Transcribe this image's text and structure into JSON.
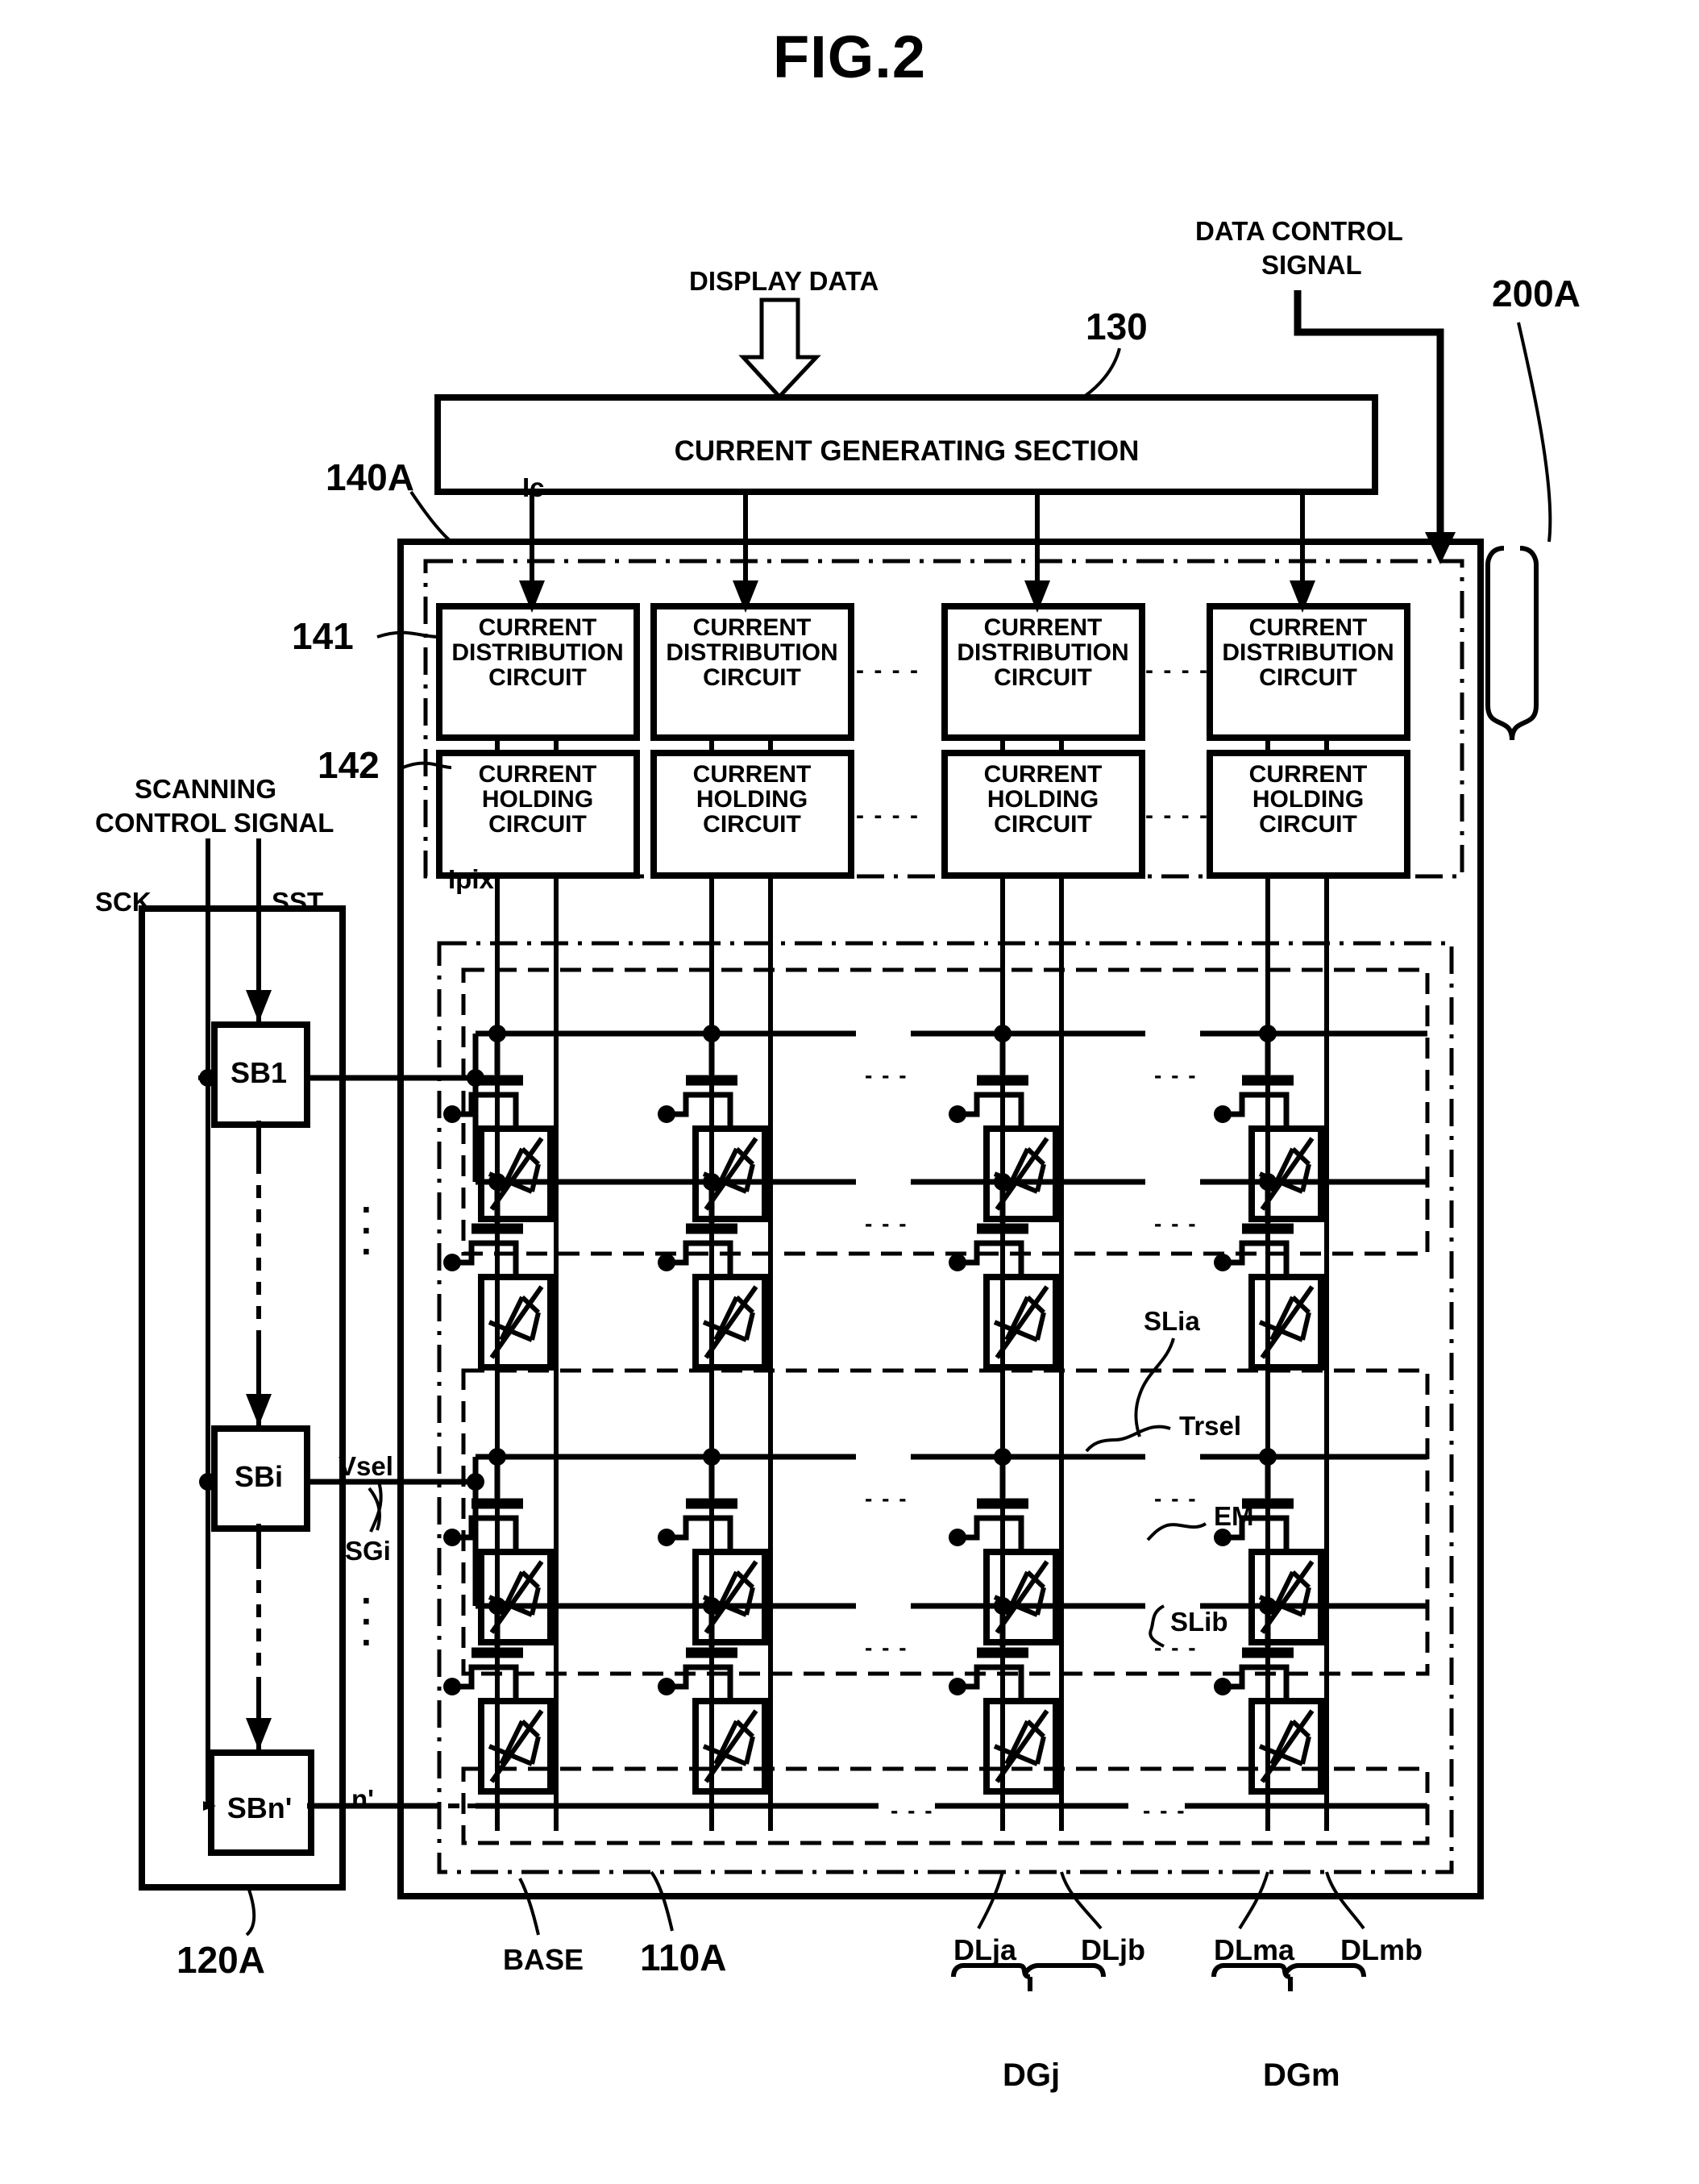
{
  "figure": {
    "title": "FIG.2",
    "reference_numerals": {
      "display_device": "200A",
      "current_generating_section": "130",
      "data_driver": "140A",
      "current_distribution_circuit": "141",
      "current_holding_circuit": "142",
      "scanning_driver": "120A",
      "display_panel": "110A",
      "base": "BASE"
    },
    "blocks": {
      "current_generating_section": "CURRENT GENERATING SECTION",
      "distribution_circuit": "CURRENT\nDISTRIBUTION\nCIRCUIT",
      "distribution_circuit_lines": [
        "CURRENT",
        "DISTRIBUTION",
        "CIRCUIT"
      ],
      "holding_circuit_lines": [
        "CURRENT",
        "HOLDING",
        "CIRCUIT"
      ],
      "shift_blocks": [
        "SB1",
        "SBi",
        "SBn'"
      ]
    },
    "input_labels": {
      "display_data": "DISPLAY DATA",
      "data_control_signal_line1": "DATA CONTROL",
      "data_control_signal_line2": "SIGNAL",
      "scanning_control_line1": "SCANNING",
      "scanning_control_line2": "CONTROL SIGNAL"
    },
    "signal_labels": {
      "ic": "Ic",
      "ipix": "Ipix",
      "sck": "SCK",
      "sst": "SST",
      "vsel": "Vsel",
      "sgi": "SGi",
      "n_prime": "n'"
    },
    "pixel_labels": {
      "scan_line_a": "SLia",
      "scan_line_b": "SLib",
      "select_transistor": "Trsel",
      "emitting_element": "EM"
    },
    "data_line_labels": {
      "dlja": "DLja",
      "dljb": "DLjb",
      "dlma": "DLma",
      "dlmb": "DLmb",
      "dgj": "DGj",
      "dgm": "DGm"
    },
    "ellipsis": "- - - -",
    "ellipsis_short": "- - -",
    "vertical_ellipsis": "⋮",
    "colors": {
      "ink": "#000000",
      "paper": "#ffffff"
    }
  }
}
